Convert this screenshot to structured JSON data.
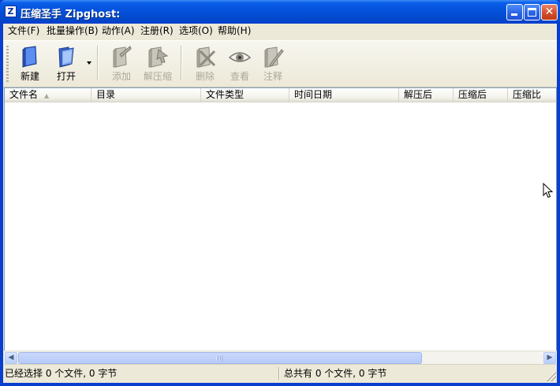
{
  "window": {
    "title": "压缩圣手 Zipghost:",
    "icon": "Z"
  },
  "menu": [
    {
      "label": "文件(F)"
    },
    {
      "label": "批量操作(B)"
    },
    {
      "label": "动作(A)"
    },
    {
      "label": "注册(R)"
    },
    {
      "label": "选项(O)"
    },
    {
      "label": "帮助(H)"
    }
  ],
  "toolbar": {
    "new": {
      "label": "新建",
      "icon": "new-archive-icon",
      "enabled": true
    },
    "open": {
      "label": "打开",
      "icon": "open-archive-icon",
      "enabled": true
    },
    "add": {
      "label": "添加",
      "icon": "add-files-icon",
      "enabled": false
    },
    "extract": {
      "label": "解压缩",
      "icon": "extract-icon",
      "enabled": false
    },
    "delete": {
      "label": "删除",
      "icon": "delete-icon",
      "enabled": false
    },
    "view": {
      "label": "查看",
      "icon": "view-eye-icon",
      "enabled": false
    },
    "comment": {
      "label": "注释",
      "icon": "comment-icon",
      "enabled": false
    }
  },
  "columns": [
    {
      "label": "文件名"
    },
    {
      "label": "目录"
    },
    {
      "label": "文件类型"
    },
    {
      "label": "时间日期"
    },
    {
      "label": "解压后"
    },
    {
      "label": "压缩后"
    },
    {
      "label": "压缩比"
    }
  ],
  "rows": [],
  "statusbar": {
    "selected": "已经选择 0 个文件, 0 字节",
    "total": "总共有 0 个文件, 0 字节"
  },
  "colors": {
    "titlebar": "#0450d8",
    "face": "#ECE9D8",
    "disabled_text": "#aca899"
  }
}
